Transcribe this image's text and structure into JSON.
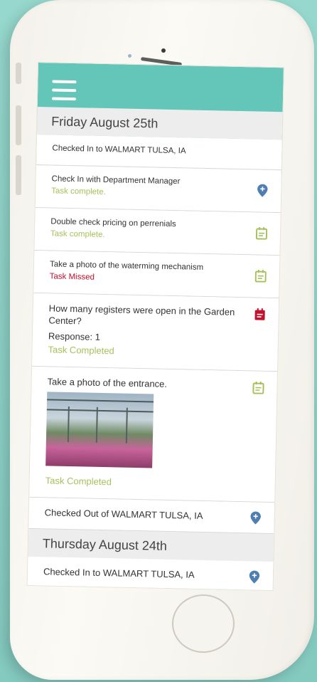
{
  "accent_color": "#63c6b8",
  "status_colors": {
    "complete": "#a6c15b",
    "missed": "#c2102e",
    "pin": "#4f7fb0"
  },
  "header": {
    "menu_icon": "hamburger-icon",
    "search_icon": "search-icon"
  },
  "sections": [
    {
      "date": "Friday August 25th",
      "items": [
        {
          "title": "Checked In to WALMART TULSA, IA",
          "status": "",
          "icon": ""
        },
        {
          "title": "Check In with Department Manager",
          "status": "Task complete.",
          "icon": "location-pin-icon"
        },
        {
          "title": "Double check pricing on perrenials",
          "status": "Task complete.",
          "icon": "task-icon"
        },
        {
          "title": "Take a photo of the waterming mechanism",
          "status": "Task Missed",
          "icon": "task-icon"
        },
        {
          "title": "How many registers were open in the Garden Center?",
          "response": "Response: 1",
          "status": "Task Completed",
          "icon": "task-icon"
        },
        {
          "title": "Take a photo of the entrance.",
          "status": "Task Completed",
          "icon": "task-icon",
          "has_photo": true
        },
        {
          "title": "Checked Out of WALMART TULSA, IA",
          "status": "",
          "icon": "location-pin-icon"
        }
      ]
    },
    {
      "date": "Thursday August 24th",
      "items": [
        {
          "title": "Checked In to WALMART TULSA, IA",
          "status": "",
          "icon": "location-pin-icon"
        }
      ]
    }
  ]
}
